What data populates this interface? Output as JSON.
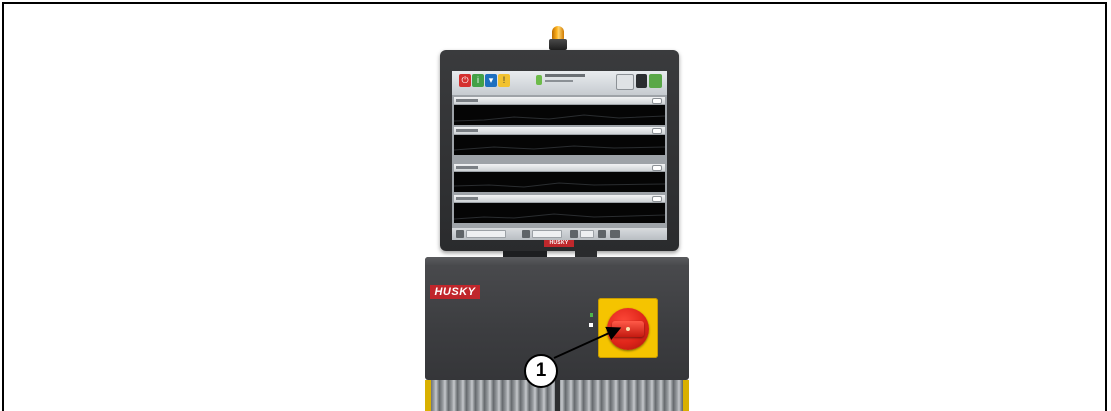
{
  "callout": {
    "number": "1"
  },
  "monitor": {
    "logo_text": "HUSKY",
    "zone_count": 4
  },
  "cabinet": {
    "badge_text": "HUSKY"
  },
  "colors": {
    "brand_red": "#c0262b",
    "switch_yellow": "#f5c400",
    "switch_red": "#e0261a",
    "beacon_amber": "#ffb21e"
  },
  "icons": {
    "beacon": "beacon-light-icon",
    "switch": "main-disconnect-switch-icon"
  }
}
